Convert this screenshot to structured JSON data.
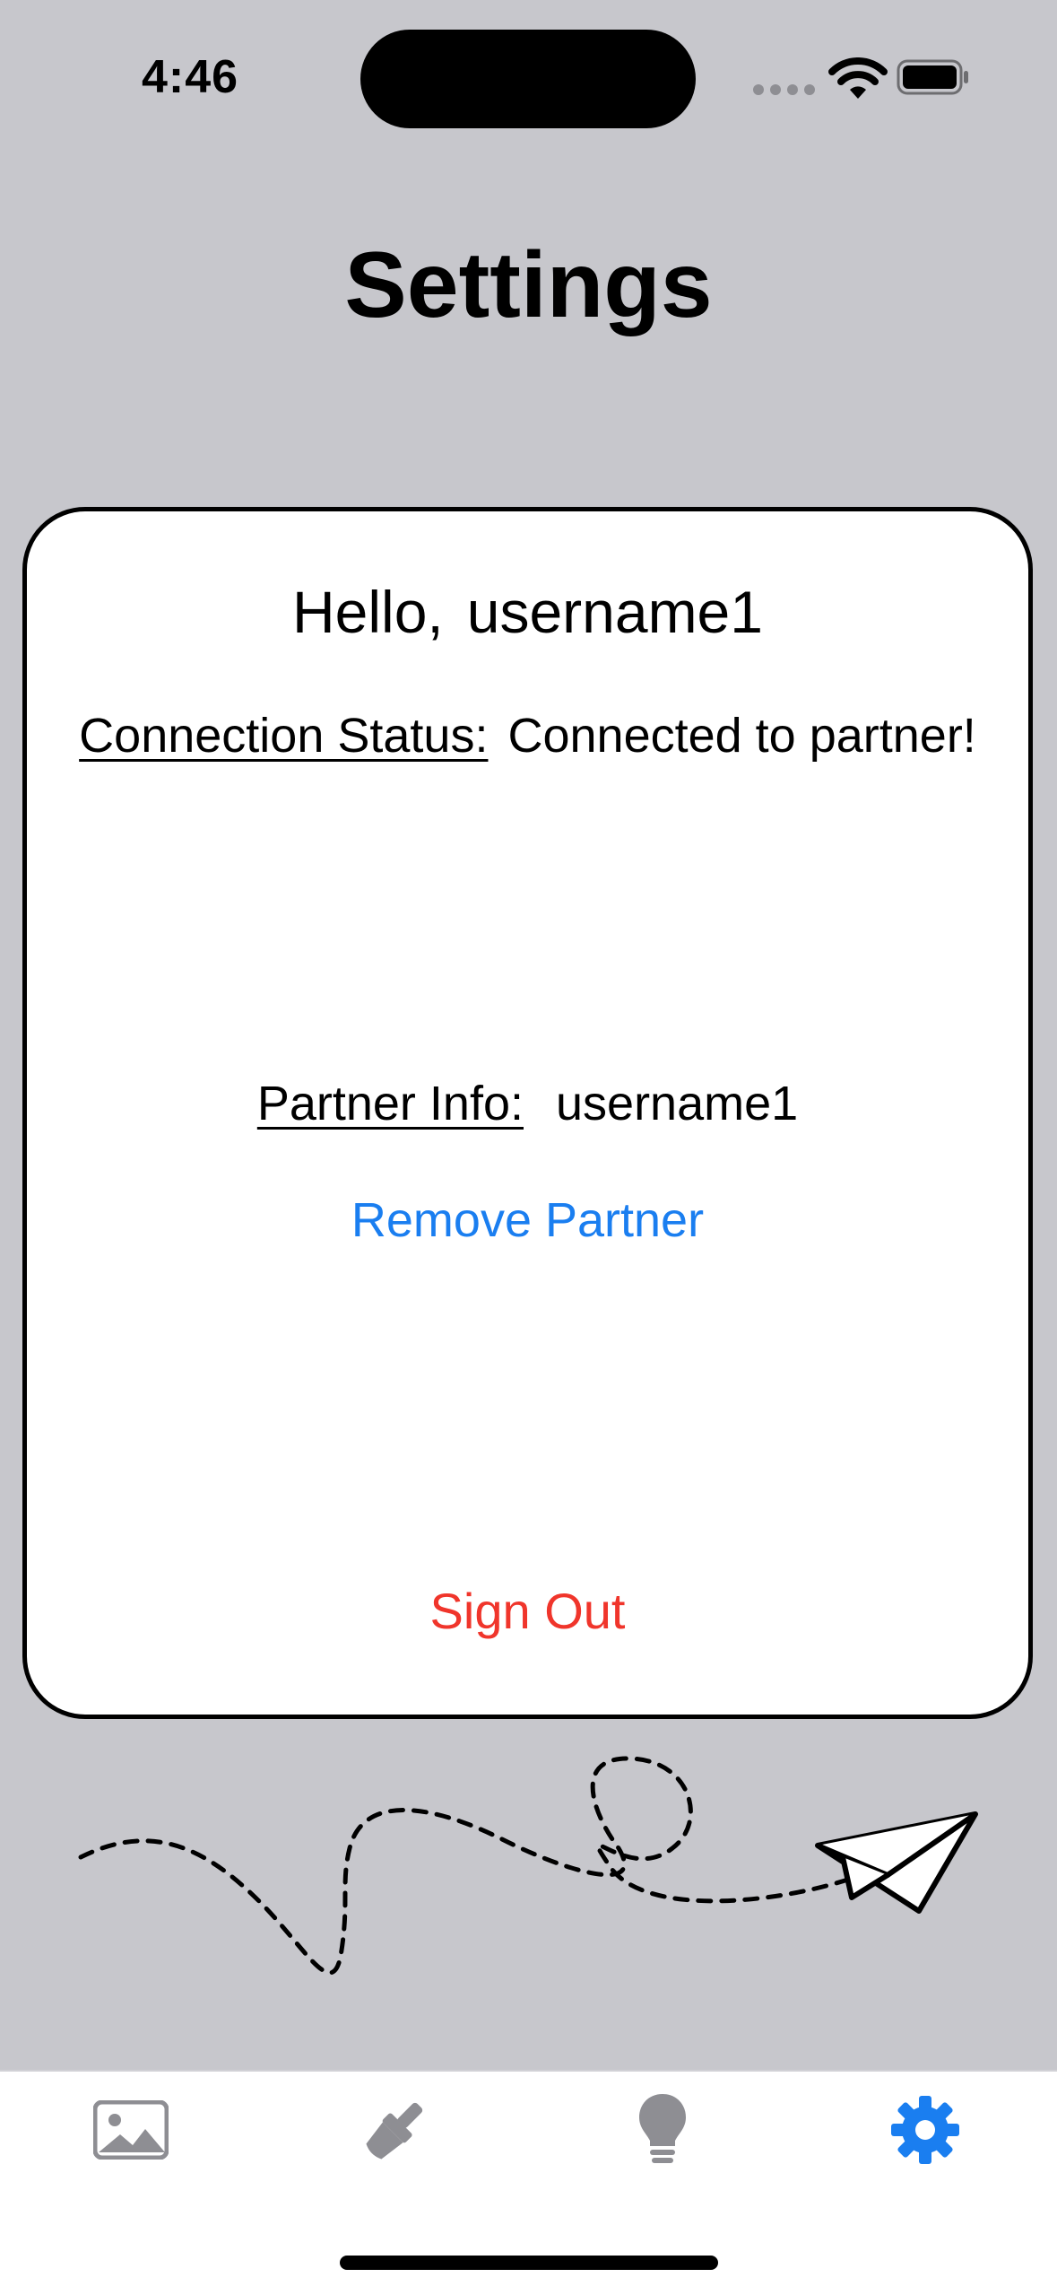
{
  "status_bar": {
    "time": "4:46"
  },
  "page": {
    "title": "Settings"
  },
  "card": {
    "greeting_prefix": "Hello,",
    "username": "username1",
    "connection_label": "Connection Status:",
    "connection_value": "Connected to partner!",
    "partner_label": "Partner Info:",
    "partner_value": "username1",
    "remove_partner_label": "Remove Partner",
    "sign_out_label": "Sign Out"
  },
  "tab_bar": {
    "tabs": [
      {
        "icon": "photo-icon",
        "active": false
      },
      {
        "icon": "paintbrush-icon",
        "active": false
      },
      {
        "icon": "lightbulb-icon",
        "active": false
      },
      {
        "icon": "gear-icon",
        "active": true
      }
    ]
  },
  "colors": {
    "background": "#c7c7cc",
    "link_blue": "#1a7ef0",
    "destructive_red": "#f0352b",
    "inactive_tab": "#8e8e93",
    "active_tab": "#1a7ef0"
  }
}
